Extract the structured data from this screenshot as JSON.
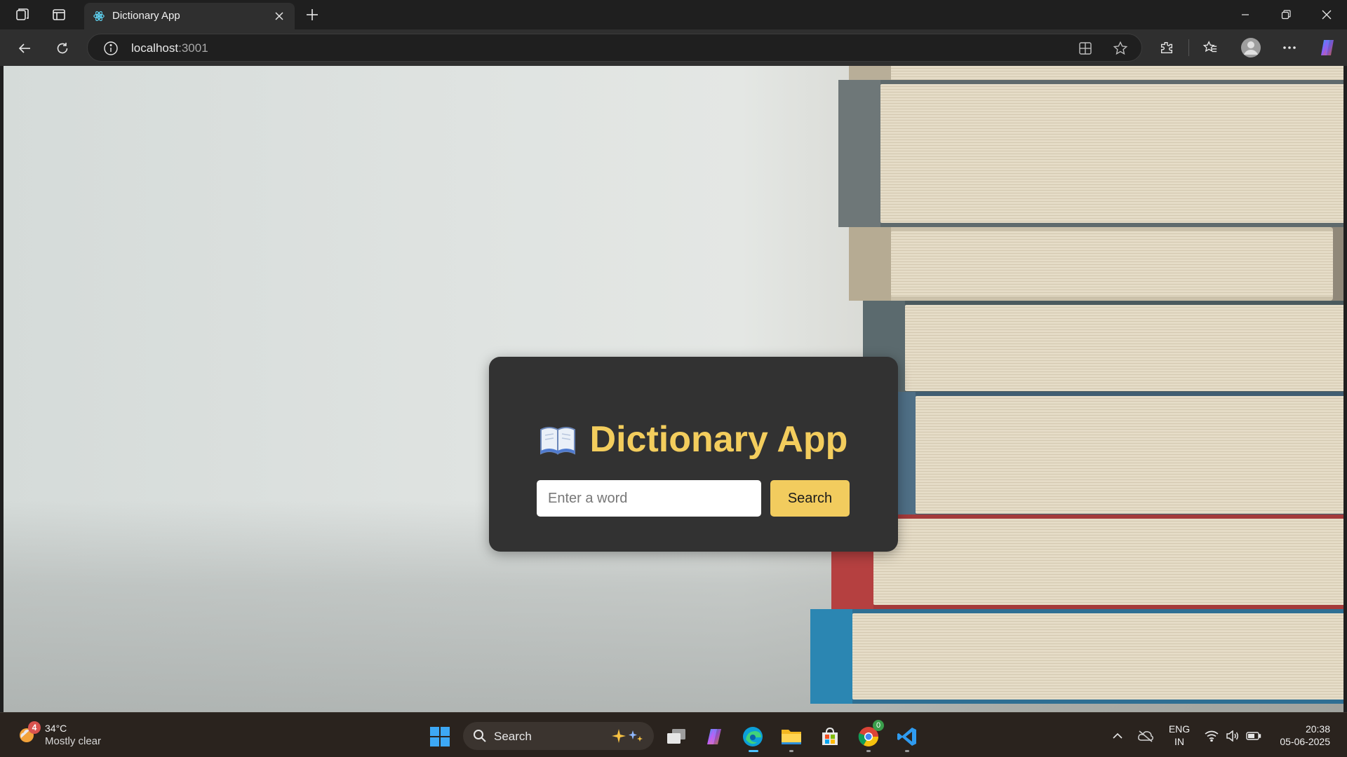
{
  "browser": {
    "tab": {
      "title": "Dictionary App"
    },
    "address": {
      "host": "localhost",
      "port": ":3001"
    }
  },
  "app": {
    "title": "Dictionary App",
    "input_placeholder": "Enter a word",
    "search_label": "Search"
  },
  "taskbar": {
    "weather": {
      "temp": "34°C",
      "desc": "Mostly clear",
      "badge": "4"
    },
    "search_label": "Search",
    "chrome_badge": "0",
    "lang_line1": "ENG",
    "lang_line2": "IN",
    "time": "20:38",
    "date": "05-06-2025"
  },
  "colors": {
    "accent": "#f3cd5d",
    "card": "#323232",
    "tab_bg": "#2f2f2f",
    "taskbar": "#2a231e"
  }
}
